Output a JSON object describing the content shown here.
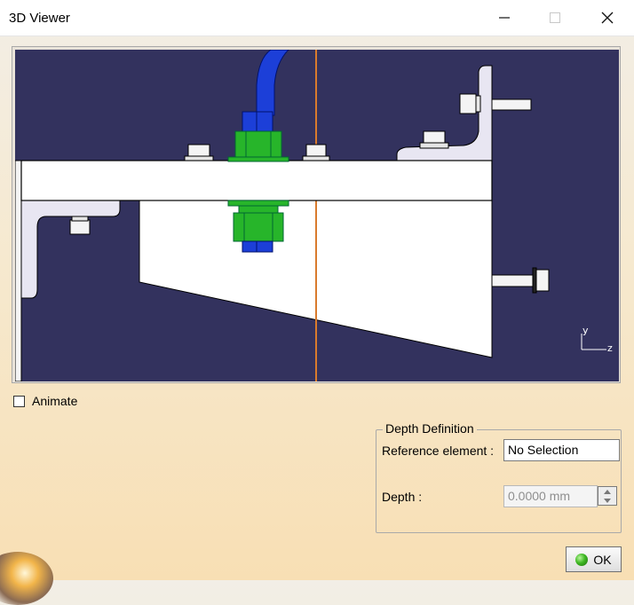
{
  "window": {
    "title": "3D Viewer",
    "controls": {
      "minimize": "minimize-icon",
      "maximize": "maximize-icon",
      "close": "close-icon"
    }
  },
  "viewer": {
    "background_color": "#33325e",
    "axis": {
      "vertical": "y",
      "horizontal": "z"
    }
  },
  "animate": {
    "label": "Animate",
    "checked": false
  },
  "depth_definition": {
    "title": "Depth Definition",
    "reference_label": "Reference element :",
    "reference_value": "No Selection",
    "depth_label": "Depth :",
    "depth_value": "0.0000 mm"
  },
  "ok_button": {
    "label": "OK",
    "icon": "green-ball-icon"
  }
}
